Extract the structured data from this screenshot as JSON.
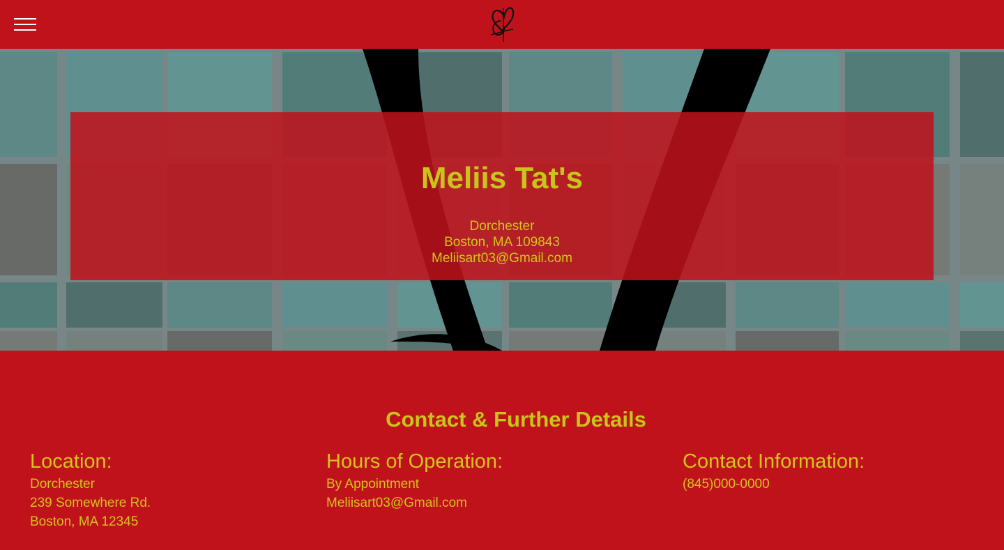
{
  "header": {
    "menu_icon": "hamburger-menu-icon",
    "logo_icon": "butterfly-heart-logo-icon"
  },
  "hero": {
    "title": "Meliis Tat's",
    "lines": [
      "Dorchester",
      "Boston, MA 109843",
      "Meliisart03@Gmail.com"
    ]
  },
  "contact": {
    "heading": "Contact & Further Details",
    "location": {
      "title": "Location:",
      "lines": [
        "Dorchester",
        "239 Somewhere Rd.",
        "Boston, MA 12345"
      ]
    },
    "hours": {
      "title": "Hours of Operation:",
      "lines": [
        "By Appointment",
        "Meliisart03@Gmail.com"
      ]
    },
    "info": {
      "title": "Contact Information:",
      "lines": [
        "(845)000-0000"
      ]
    }
  },
  "colors": {
    "brand_red": "#c0121b",
    "accent_yellow": "#c9c41a"
  }
}
